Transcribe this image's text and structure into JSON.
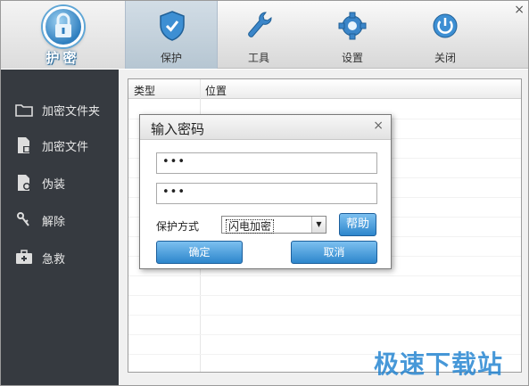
{
  "header": {
    "logo_text": "护密",
    "tabs": [
      {
        "label": "保护",
        "icon": "shield-icon"
      },
      {
        "label": "工具",
        "icon": "wrench-icon"
      },
      {
        "label": "设置",
        "icon": "gear-icon"
      },
      {
        "label": "关闭",
        "icon": "power-icon"
      }
    ],
    "close_glyph": "×"
  },
  "sidebar": {
    "items": [
      {
        "label": "加密文件夹",
        "icon": "folder-icon"
      },
      {
        "label": "加密文件",
        "icon": "file-lock-icon"
      },
      {
        "label": "伪装",
        "icon": "disguise-icon"
      },
      {
        "label": "解除",
        "icon": "key-icon"
      },
      {
        "label": "急救",
        "icon": "first-aid-icon"
      }
    ]
  },
  "list": {
    "columns": [
      "类型",
      "位置"
    ]
  },
  "dialog": {
    "title": "输入密码",
    "close_glyph": "×",
    "password1": "•••",
    "password2": "•••",
    "mode_label": "保护方式",
    "mode_value": "闪电加密",
    "help_label": "帮助",
    "ok_label": "确定",
    "cancel_label": "取消"
  },
  "watermark": "极速下载站",
  "colors": {
    "sidebar_bg": "#363a40",
    "accent_blue": "#2d86cc"
  }
}
